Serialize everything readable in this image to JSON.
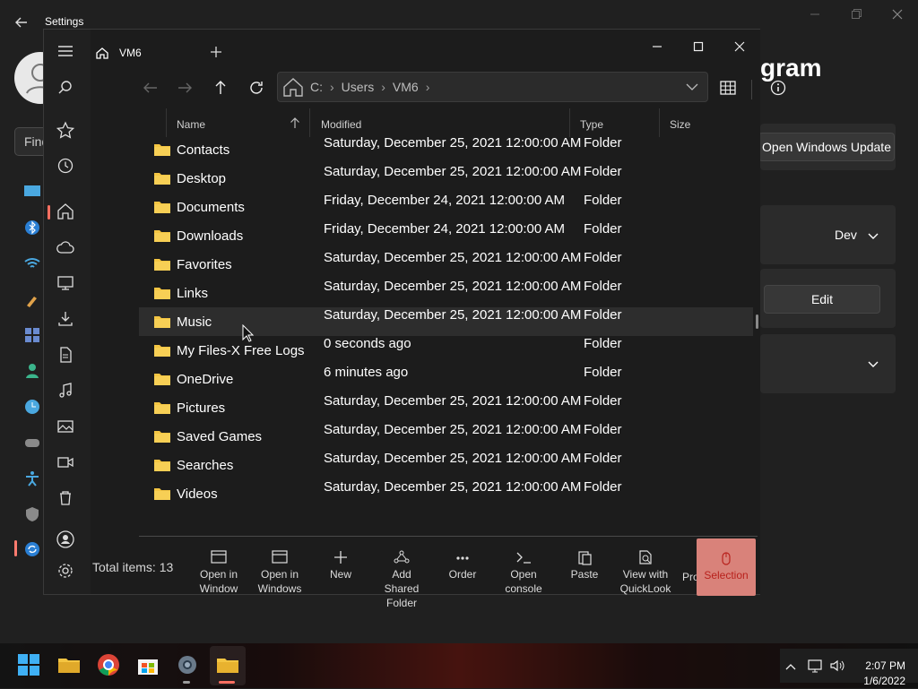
{
  "settings": {
    "title": "Settings",
    "heading_partial": "gram",
    "search_partial": "Find",
    "update_button": "Open Windows Update",
    "channel_value": "Dev",
    "edit_button": "Edit"
  },
  "files": {
    "tab_label": "VM6",
    "address": {
      "crumbs": [
        "C:",
        "Users",
        "VM6"
      ],
      "separator": "›"
    },
    "columns": {
      "name": "Name",
      "modified": "Modified",
      "type": "Type",
      "size": "Size"
    },
    "rows": [
      {
        "name": "Contacts",
        "modified": "Saturday, December 25, 2021 12:00:00 AM",
        "type": "Folder"
      },
      {
        "name": "Desktop",
        "modified": "Saturday, December 25, 2021 12:00:00 AM",
        "type": "Folder"
      },
      {
        "name": "Documents",
        "modified": "Friday, December 24, 2021 12:00:00 AM",
        "type": "Folder"
      },
      {
        "name": "Downloads",
        "modified": "Friday, December 24, 2021 12:00:00 AM",
        "type": "Folder"
      },
      {
        "name": "Favorites",
        "modified": "Saturday, December 25, 2021 12:00:00 AM",
        "type": "Folder"
      },
      {
        "name": "Links",
        "modified": "Saturday, December 25, 2021 12:00:00 AM",
        "type": "Folder"
      },
      {
        "name": "Music",
        "modified": "Saturday, December 25, 2021 12:00:00 AM",
        "type": "Folder"
      },
      {
        "name": "My Files-X Free Logs",
        "modified": "0 seconds ago",
        "type": "Folder"
      },
      {
        "name": "OneDrive",
        "modified": "6 minutes ago",
        "type": "Folder"
      },
      {
        "name": "Pictures",
        "modified": "Saturday, December 25, 2021 12:00:00 AM",
        "type": "Folder"
      },
      {
        "name": "Saved Games",
        "modified": "Saturday, December 25, 2021 12:00:00 AM",
        "type": "Folder"
      },
      {
        "name": "Searches",
        "modified": "Saturday, December 25, 2021 12:00:00 AM",
        "type": "Folder"
      },
      {
        "name": "Videos",
        "modified": "Saturday, December 25, 2021 12:00:00 AM",
        "type": "Folder"
      }
    ],
    "total_items": "Total items: 13",
    "commands": {
      "open_in_window": [
        "Open in",
        "Window"
      ],
      "open_in_windows": [
        "Open in",
        "Windows"
      ],
      "new": [
        "New"
      ],
      "add_shared_folder": [
        "Add Shared",
        "Folder"
      ],
      "order": [
        "Order"
      ],
      "open_console": [
        "Open",
        "console"
      ],
      "paste": [
        "Paste"
      ],
      "view_quicklook": [
        "View with",
        "QuickLook"
      ],
      "properties_partial": "Pro",
      "selection": "Selection"
    }
  },
  "taskbar": {
    "time": "2:07 PM",
    "date": "1/6/2022"
  },
  "colors": {
    "accent": "#ff6f61",
    "folder": "#f4c542",
    "selection_bg": "#d9827a"
  }
}
